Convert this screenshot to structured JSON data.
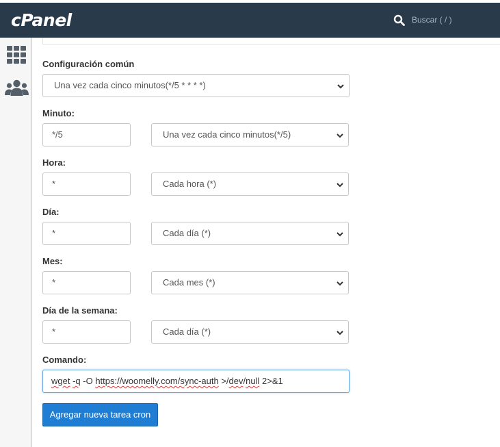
{
  "header": {
    "logo": "cPanel",
    "search_placeholder": "Buscar ( / )"
  },
  "form": {
    "common": {
      "label": "Configuración común",
      "value": "Una vez cada cinco minutos(*/5 * * * *)"
    },
    "minute": {
      "label": "Minuto:",
      "value": "*/5",
      "select": "Una vez cada cinco minutos(*/5)"
    },
    "hour": {
      "label": "Hora:",
      "value": "*",
      "select": "Cada hora (*)"
    },
    "day": {
      "label": "Día:",
      "value": "*",
      "select": "Cada día (*)"
    },
    "month": {
      "label": "Mes:",
      "value": "*",
      "select": "Cada mes (*)"
    },
    "weekday": {
      "label": "Día de la semana:",
      "value": "*",
      "select": "Cada día (*)"
    },
    "command": {
      "label": "Comando:",
      "parts": {
        "p1": "wget",
        "p2": " ",
        "p3": "-q",
        "p4": " -O ",
        "p5": "https://woomelly.com/sync-auth",
        "p6": " >/",
        "p7": "dev",
        "p8": "/",
        "p9": "null",
        "p10": " 2>&1"
      }
    },
    "submit_label": "Agregar nueva tarea cron"
  },
  "colors": {
    "header_bg": "#293a4a",
    "primary_button": "#1f7dd4",
    "focus_border": "#66a3dc"
  }
}
